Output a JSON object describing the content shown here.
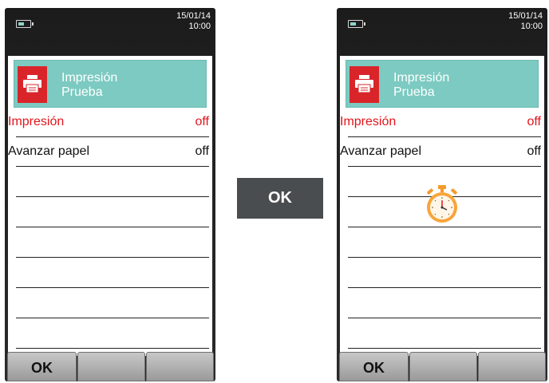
{
  "colors": {
    "accent_red": "#e2141b",
    "header_teal": "#7ccac1",
    "stopwatch_orange": "#f39a2c"
  },
  "transition_button": {
    "label": "OK"
  },
  "devices": [
    {
      "status": {
        "date": "15/01/14",
        "time": "10:00",
        "icon": "battery-icon"
      },
      "header": {
        "line1": "Impresión",
        "line2": "Prueba",
        "icon": "printer-icon"
      },
      "menu": [
        {
          "label": "Impresión",
          "value": "off",
          "selected": true
        },
        {
          "label": "Avanzar papel",
          "value": "off",
          "selected": false
        }
      ],
      "softkeys": [
        "OK",
        "",
        ""
      ]
    },
    {
      "status": {
        "date": "15/01/14",
        "time": "10:00",
        "icon": "battery-icon"
      },
      "header": {
        "line1": "Impresión",
        "line2": "Prueba",
        "icon": "printer-icon"
      },
      "menu": [
        {
          "label": "Impresión",
          "value": "off",
          "selected": true
        },
        {
          "label": "Avanzar papel",
          "value": "off",
          "selected": false
        }
      ],
      "overlay_icon": "stopwatch-icon",
      "softkeys": [
        "OK",
        "",
        ""
      ]
    }
  ]
}
